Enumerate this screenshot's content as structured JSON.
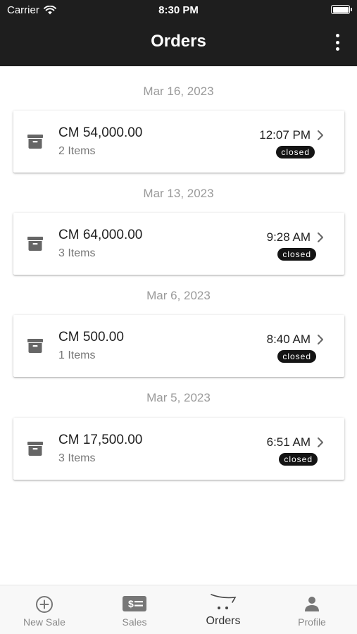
{
  "status_bar": {
    "carrier": "Carrier",
    "time": "8:30 PM"
  },
  "header": {
    "title": "Orders",
    "menu_icon": "more-vertical-icon"
  },
  "groups": [
    {
      "date": "Mar 16, 2023",
      "order": {
        "amount": "CM 54,000.00",
        "items": "2 Items",
        "time": "12:07 PM",
        "status": "closed"
      }
    },
    {
      "date": "Mar 13, 2023",
      "order": {
        "amount": "CM 64,000.00",
        "items": "3 Items",
        "time": "9:28 AM",
        "status": "closed"
      }
    },
    {
      "date": "Mar 6, 2023",
      "order": {
        "amount": "CM 500.00",
        "items": "1 Items",
        "time": "8:40 AM",
        "status": "closed"
      }
    },
    {
      "date": "Mar 5, 2023",
      "order": {
        "amount": "CM 17,500.00",
        "items": "3 Items",
        "time": "6:51 AM",
        "status": "closed"
      }
    }
  ],
  "bottom_nav": {
    "items": [
      {
        "label": "New Sale",
        "icon": "plus-circle-icon",
        "active": false
      },
      {
        "label": "Sales",
        "icon": "cash-icon",
        "active": false
      },
      {
        "label": "Orders",
        "icon": "cart-icon",
        "active": true
      },
      {
        "label": "Profile",
        "icon": "person-icon",
        "active": false
      }
    ]
  },
  "colors": {
    "header_bg": "#1e1e1e",
    "badge_bg": "#141414",
    "date_text": "#9a9a9a"
  }
}
